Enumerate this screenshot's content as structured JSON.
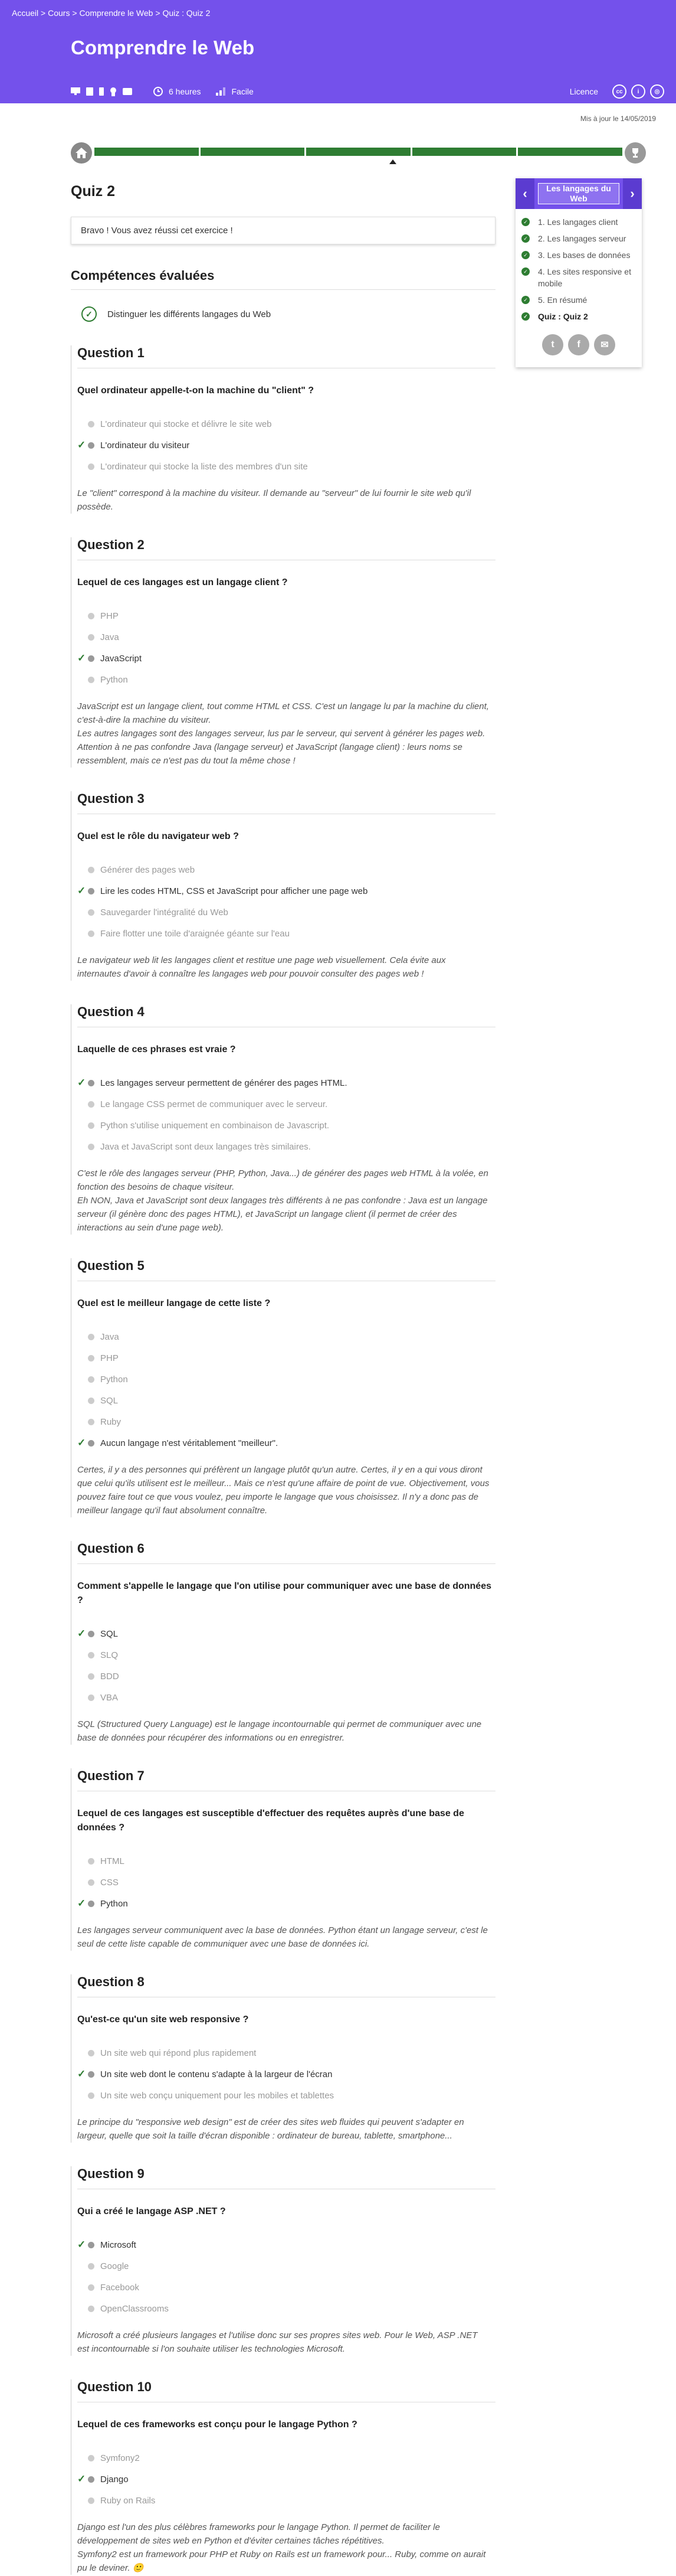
{
  "breadcrumb": {
    "home": "Accueil",
    "courses": "Cours",
    "course": "Comprendre le Web",
    "current": "Quiz : Quiz 2",
    "sep": " > "
  },
  "header": {
    "title": "Comprendre le Web",
    "duration": "6 heures",
    "level": "Facile",
    "license": "Licence"
  },
  "updated": "Mis à jour le 14/05/2019",
  "quiz_title": "Quiz 2",
  "success_msg": "Bravo ! Vous avez réussi cet exercice !",
  "skills_title": "Compétences évaluées",
  "skill": "Distinguer les différents langages du Web",
  "sidebar": {
    "title": "Les langages du Web",
    "items": [
      {
        "label": "1. Les langages client"
      },
      {
        "label": "2. Les langages serveur"
      },
      {
        "label": "3. Les bases de données"
      },
      {
        "label": "4. Les sites responsive et mobile"
      },
      {
        "label": "5. En résumé"
      },
      {
        "label": "Quiz : Quiz 2"
      }
    ]
  },
  "questions": [
    {
      "title": "Question 1",
      "text": "Quel ordinateur appelle-t-on la machine du \"client\" ?",
      "options": [
        {
          "t": "L'ordinateur qui stocke et délivre le site web",
          "ok": false
        },
        {
          "t": "L'ordinateur du visiteur",
          "ok": true
        },
        {
          "t": "L'ordinateur qui stocke la liste des membres d'un site",
          "ok": false
        }
      ],
      "expl": "Le \"client\" correspond à la machine du visiteur. Il demande au \"serveur\" de lui fournir le site web qu'il possède."
    },
    {
      "title": "Question 2",
      "text": "Lequel de ces langages est un langage client ?",
      "options": [
        {
          "t": "PHP",
          "ok": false
        },
        {
          "t": "Java",
          "ok": false
        },
        {
          "t": "JavaScript",
          "ok": true
        },
        {
          "t": "Python",
          "ok": false
        }
      ],
      "expl": "JavaScript est un langage client, tout comme HTML et CSS. C'est un langage lu par la machine du client, c'est-à-dire la machine du visiteur.\nLes autres langages sont des langages serveur, lus par le serveur, qui servent à générer les pages web. Attention à ne pas confondre Java (langage serveur) et JavaScript (langage client) : leurs noms se ressemblent, mais ce n'est pas du tout la même chose !"
    },
    {
      "title": "Question 3",
      "text": "Quel est le rôle du navigateur web ?",
      "options": [
        {
          "t": "Générer des pages web",
          "ok": false
        },
        {
          "t": "Lire les codes HTML, CSS et JavaScript pour afficher une page web",
          "ok": true
        },
        {
          "t": "Sauvegarder l'intégralité du Web",
          "ok": false
        },
        {
          "t": "Faire flotter une toile d'araignée géante sur l'eau",
          "ok": false
        }
      ],
      "expl": "Le navigateur web lit les langages client et restitue une page web visuellement. Cela évite aux internautes d'avoir à connaître les langages web pour pouvoir consulter des pages web !"
    },
    {
      "title": "Question 4",
      "text": "Laquelle de ces phrases est vraie ?",
      "options": [
        {
          "t": "Les langages serveur permettent de générer des pages HTML.",
          "ok": true
        },
        {
          "t": "Le langage CSS permet de communiquer avec le serveur.",
          "ok": false
        },
        {
          "t": "Python s'utilise uniquement en combinaison de Javascript.",
          "ok": false
        },
        {
          "t": "Java et JavaScript sont deux langages très similaires.",
          "ok": false
        }
      ],
      "expl": "C'est le rôle des langages serveur (PHP, Python, Java...) de générer des pages web HTML à la volée, en fonction des besoins de chaque visiteur.\nEh NON, Java et JavaScript sont deux langages très différents à ne pas confondre : Java est un langage serveur (il génère donc des pages HTML), et JavaScript un langage client (il permet de créer des interactions au sein d'une page web)."
    },
    {
      "title": "Question 5",
      "text": "Quel est le meilleur langage de cette liste ?",
      "options": [
        {
          "t": "Java",
          "ok": false
        },
        {
          "t": "PHP",
          "ok": false
        },
        {
          "t": "Python",
          "ok": false
        },
        {
          "t": "SQL",
          "ok": false
        },
        {
          "t": "Ruby",
          "ok": false
        },
        {
          "t": "Aucun langage n'est véritablement \"meilleur\".",
          "ok": true
        }
      ],
      "expl": "Certes, il y a des personnes qui préfèrent un langage plutôt qu'un autre. Certes, il y en a qui vous diront que celui qu'ils utilisent est le meilleur... Mais ce n'est qu'une affaire de point de vue. Objectivement, vous pouvez faire tout ce que vous voulez, peu importe le langage que vous choisissez. Il n'y a donc pas de meilleur langage qu'il faut absolument connaître."
    },
    {
      "title": "Question 6",
      "text": "Comment s'appelle le langage que l'on utilise pour communiquer avec une base de données ?",
      "options": [
        {
          "t": "SQL",
          "ok": true
        },
        {
          "t": "SLQ",
          "ok": false
        },
        {
          "t": "BDD",
          "ok": false
        },
        {
          "t": "VBA",
          "ok": false
        }
      ],
      "expl": "SQL (Structured Query Language) est le langage incontournable qui permet de communiquer avec une base de données pour récupérer des informations ou en enregistrer."
    },
    {
      "title": "Question 7",
      "text": "Lequel de ces langages est susceptible d'effectuer des requêtes auprès d'une base de données ?",
      "options": [
        {
          "t": "HTML",
          "ok": false
        },
        {
          "t": "CSS",
          "ok": false
        },
        {
          "t": "Python",
          "ok": true
        }
      ],
      "expl": "Les langages serveur communiquent avec la base de données. Python étant un langage serveur, c'est le seul de cette liste capable de communiquer avec une base de données ici."
    },
    {
      "title": "Question 8",
      "text": "Qu'est-ce qu'un site web responsive ?",
      "options": [
        {
          "t": "Un site web qui répond plus rapidement",
          "ok": false
        },
        {
          "t": "Un site web dont le contenu s'adapte à la largeur de l'écran",
          "ok": true
        },
        {
          "t": "Un site web conçu uniquement pour les mobiles et tablettes",
          "ok": false
        }
      ],
      "expl": "Le principe du \"responsive web design\" est de créer des sites web fluides qui peuvent s'adapter en largeur, quelle que soit la taille d'écran disponible : ordinateur de bureau, tablette, smartphone..."
    },
    {
      "title": "Question 9",
      "text": "Qui a créé le langage ASP .NET ?",
      "options": [
        {
          "t": "Microsoft",
          "ok": true
        },
        {
          "t": "Google",
          "ok": false
        },
        {
          "t": "Facebook",
          "ok": false
        },
        {
          "t": "OpenClassrooms",
          "ok": false
        }
      ],
      "expl": "Microsoft a créé plusieurs langages et l'utilise donc sur ses propres sites web. Pour le Web, ASP .NET est incontournable si l'on souhaite utiliser les technologies Microsoft."
    },
    {
      "title": "Question 10",
      "text": "Lequel de ces frameworks est conçu pour le langage Python ?",
      "options": [
        {
          "t": "Symfony2",
          "ok": false
        },
        {
          "t": "Django",
          "ok": true
        },
        {
          "t": "Ruby on Rails",
          "ok": false
        }
      ],
      "expl": "Django est l'un des plus célèbres frameworks pour le langage Python. Il permet de faciliter le développement de sites web en Python et d'éviter certaines tâches répétitives.\nSymfony2 est un framework pour PHP et Ruby on Rails est un framework pour... Ruby, comme on aurait pu le deviner. 🙂"
    }
  ]
}
